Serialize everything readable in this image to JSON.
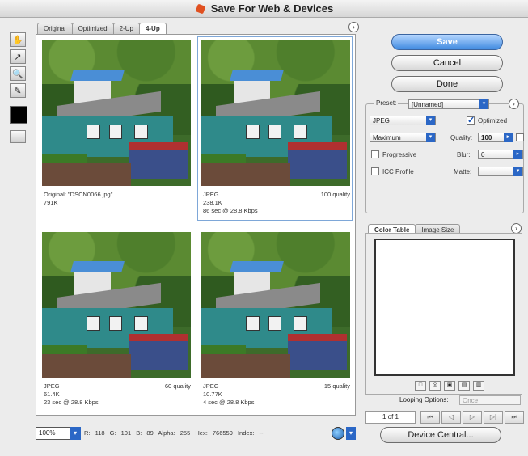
{
  "window": {
    "title": "Save For Web & Devices"
  },
  "tabs": [
    "Original",
    "Optimized",
    "2-Up",
    "4-Up"
  ],
  "active_tab": "4-Up",
  "cells": [
    {
      "line1": "Original: \"DSCN0066.jpg\"",
      "line2": "791K",
      "line3": "",
      "quality": ""
    },
    {
      "line1": "JPEG",
      "line2": "238.1K",
      "line3": "86 sec @ 28.8 Kbps",
      "quality": "100 quality"
    },
    {
      "line1": "JPEG",
      "line2": "61.4K",
      "line3": "23 sec @ 28.8 Kbps",
      "quality": "60 quality"
    },
    {
      "line1": "JPEG",
      "line2": "10.77K",
      "line3": "4 sec @ 28.8 Kbps",
      "quality": "15 quality"
    }
  ],
  "buttons": {
    "save": "Save",
    "cancel": "Cancel",
    "done": "Done",
    "device_central": "Device Central..."
  },
  "preset": {
    "label": "Preset:",
    "value": "[Unnamed]",
    "format": "JPEG",
    "compression": "Maximum",
    "optimized_label": "Optimized",
    "optimized": true,
    "quality_label": "Quality:",
    "quality_value": "100",
    "progressive_label": "Progressive",
    "blur_label": "Blur:",
    "blur_value": "0",
    "icc_label": "ICC Profile",
    "matte_label": "Matte:"
  },
  "color_table": {
    "tab1": "Color Table",
    "tab2": "Image Size"
  },
  "looping": {
    "label": "Looping Options:",
    "value": "Once"
  },
  "frames": {
    "count": "1 of 1"
  },
  "status": {
    "zoom": "100%",
    "readout": "R: 118  G: 101  B: 89  Alpha: 255  Hex: 766559  Index: --"
  }
}
